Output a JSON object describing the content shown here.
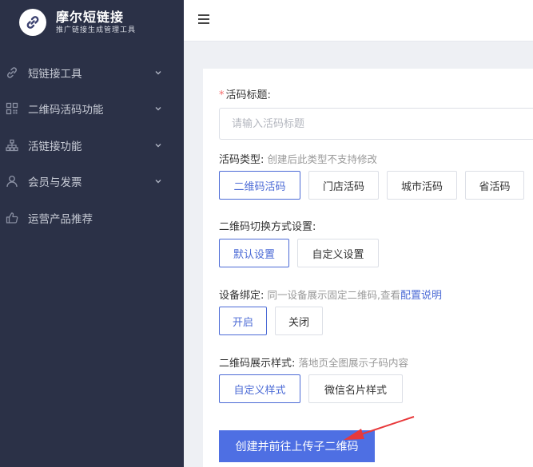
{
  "brand": {
    "name": "摩尔短链接",
    "subtitle": "推广链接生成管理工具"
  },
  "sidebar": {
    "items": [
      {
        "label": "短链接工具",
        "icon": "link-icon",
        "has_children": true
      },
      {
        "label": "二维码活码功能",
        "icon": "qrcode-icon",
        "has_children": true
      },
      {
        "label": "活链接功能",
        "icon": "sitemap-icon",
        "has_children": true
      },
      {
        "label": "会员与发票",
        "icon": "user-icon",
        "has_children": true
      },
      {
        "label": "运营产品推荐",
        "icon": "thumbs-up-icon",
        "has_children": false
      }
    ]
  },
  "topbar": {
    "menu_icon": "hamburger-icon"
  },
  "form": {
    "title_field": {
      "required_mark": "*",
      "label": "活码标题:",
      "placeholder": "请输入活码标题",
      "value": ""
    },
    "type_field": {
      "label": "活码类型:",
      "hint": "创建后此类型不支持修改",
      "options": [
        "二维码活码",
        "门店活码",
        "城市活码",
        "省活码"
      ],
      "selected": "二维码活码"
    },
    "switch_field": {
      "label": "二维码切换方式设置:",
      "options": [
        "默认设置",
        "自定义设置"
      ],
      "selected": "默认设置"
    },
    "device_field": {
      "label": "设备绑定:",
      "hint": "同一设备展示固定二维码,查看",
      "link": "配置说明",
      "options": [
        "开启",
        "关闭"
      ],
      "selected": "开启"
    },
    "style_field": {
      "label": "二维码展示样式:",
      "hint": "落地页全图展示子码内容",
      "options": [
        "自定义样式",
        "微信名片样式"
      ],
      "selected": "自定义样式"
    },
    "submit_label": "创建并前往上传子二维码"
  },
  "colors": {
    "sidebar_bg": "#2b3147",
    "accent": "#4c6bd6",
    "button_bg": "#4e6fe3",
    "annotation_arrow": "#e8393b"
  }
}
